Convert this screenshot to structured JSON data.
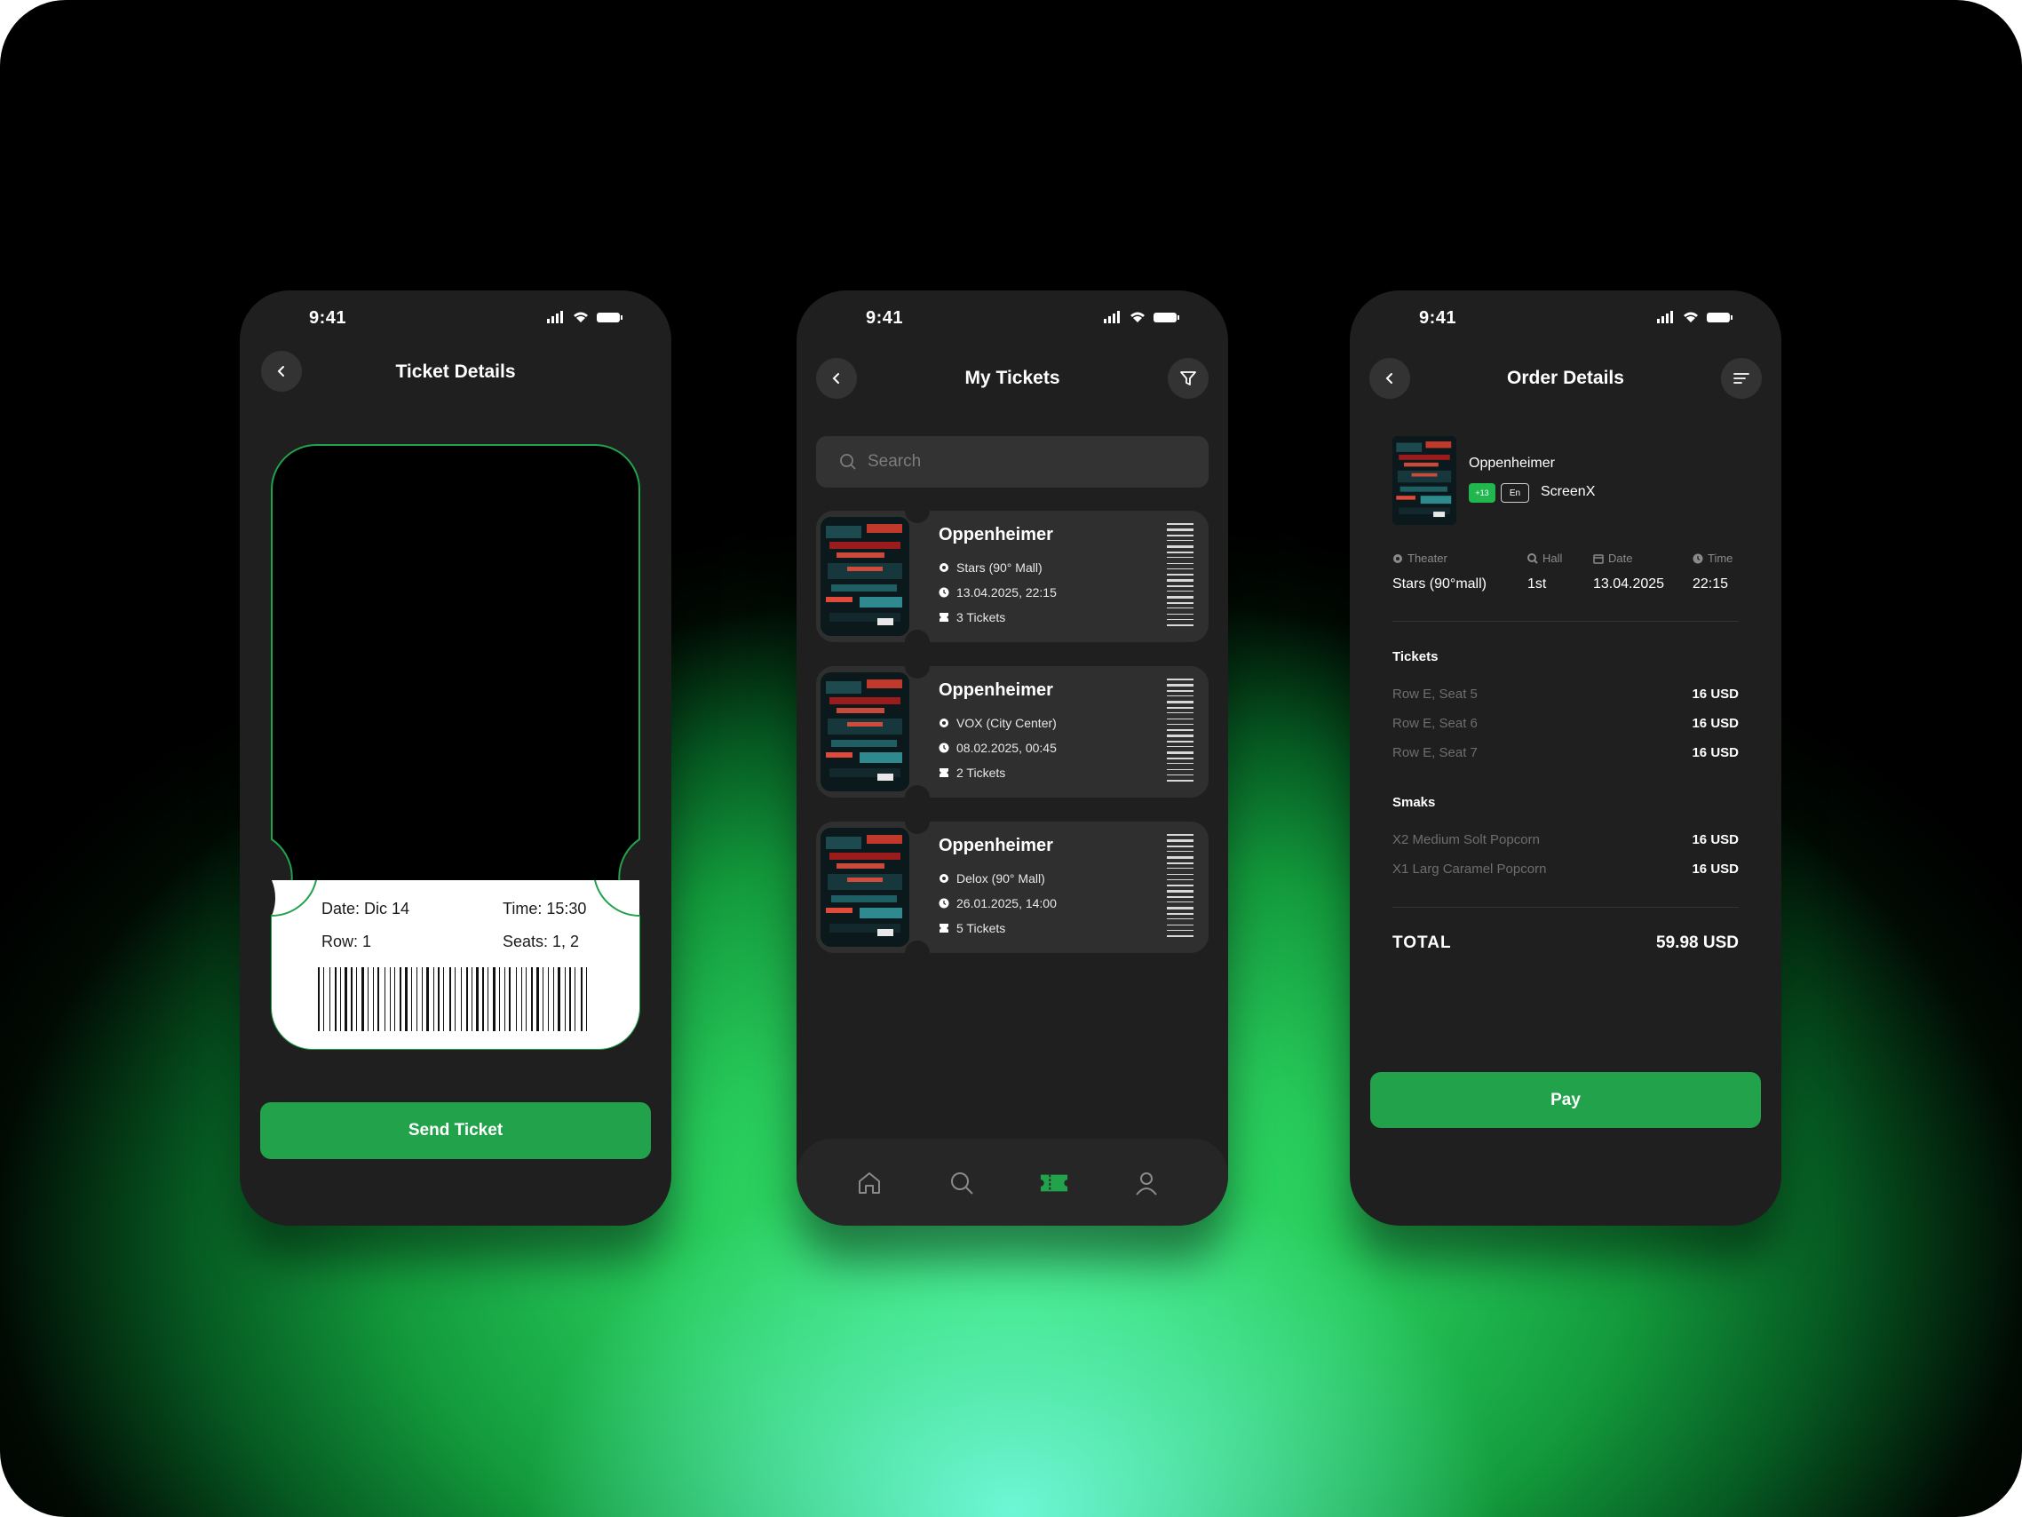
{
  "colors": {
    "accent": "#22a24b",
    "phone_bg": "#1f1f1f",
    "card_bg": "#2f2f2f"
  },
  "status": {
    "time": "9:41"
  },
  "ticket_details": {
    "title": "Ticket Details",
    "date": "Date: Dic 14",
    "time": "Time: 15:30",
    "row": "Row: 1",
    "seats": "Seats: 1, 2",
    "send_label": "Send Ticket"
  },
  "my_tickets": {
    "title": "My Tickets",
    "search_placeholder": "Search",
    "tickets": [
      {
        "movie": "Oppenheimer",
        "place": "Stars (90° Mall)",
        "datetime": "13.04.2025,  22:15",
        "count": "3 Tickets"
      },
      {
        "movie": "Oppenheimer",
        "place": "VOX (City Center)",
        "datetime": "08.02.2025,  00:45",
        "count": "2 Tickets"
      },
      {
        "movie": "Oppenheimer",
        "place": "Delox (90° Mall)",
        "datetime": "26.01.2025,  14:00",
        "count": "5 Tickets"
      }
    ],
    "nav": [
      "home-icon",
      "search-icon",
      "ticket-icon",
      "profile-icon"
    ],
    "nav_active": "ticket-icon"
  },
  "order_details": {
    "title": "Order Details",
    "movie": "Oppenheimer",
    "age_badge": "+13",
    "lang_badge": "En",
    "format": "ScreenX",
    "info": {
      "theater_label": "Theater",
      "theater": "Stars (90°mall)",
      "hall_label": "Hall",
      "hall": "1st",
      "date_label": "Date",
      "date": "13.04.2025",
      "time_label": "Time",
      "time": "22:15"
    },
    "tickets_title": "Tickets",
    "tickets": [
      {
        "label": "Row E, Seat 5",
        "price": "16 USD"
      },
      {
        "label": "Row E, Seat 6",
        "price": "16 USD"
      },
      {
        "label": "Row E, Seat 7",
        "price": "16 USD"
      }
    ],
    "snacks_title": "Smaks",
    "snacks": [
      {
        "label": "X2  Medium Solt Popcorn",
        "price": "16 USD"
      },
      {
        "label": "X1  Larg Caramel Popcorn",
        "price": "16 USD"
      }
    ],
    "total_label": "TOTAL",
    "total_value": "59.98 USD",
    "pay_label": "Pay"
  }
}
